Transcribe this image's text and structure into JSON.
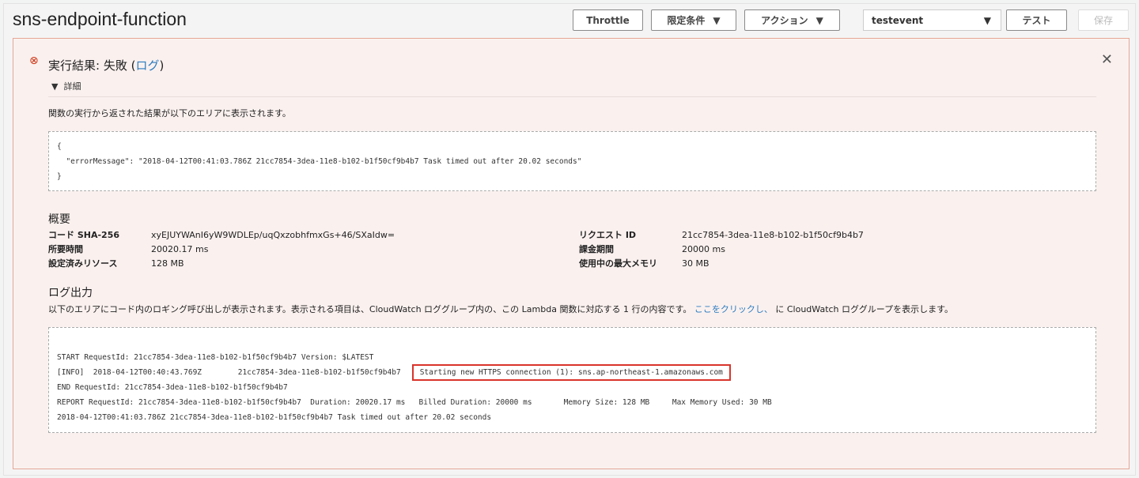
{
  "header": {
    "title": "sns-endpoint-function",
    "throttle": "Throttle",
    "qualifiers": "限定条件",
    "actions": "アクション",
    "test_event": "testevent",
    "test": "テスト",
    "save": "保存"
  },
  "result": {
    "title_prefix": "実行結果: 失敗 (",
    "log_link": "ログ",
    "title_suffix": ")",
    "details": "詳細",
    "description": "関数の実行から返された結果が以下のエリアに表示されます。",
    "output": [
      "{",
      "  \"errorMessage\": \"2018-04-12T00:41:03.786Z 21cc7854-3dea-11e8-b102-b1f50cf9b4b7 Task timed out after 20.02 seconds\"",
      "}"
    ]
  },
  "summary": {
    "heading": "概要",
    "left": [
      {
        "k": "コード SHA-256",
        "v": "xyEJUYWAnI6yW9WDLEp/uqQxzobhfmxGs+46/SXaIdw="
      },
      {
        "k": "所要時間",
        "v": "20020.17 ms"
      },
      {
        "k": "設定済みリソース",
        "v": "128 MB"
      }
    ],
    "right": [
      {
        "k": "リクエスト ID",
        "v": "21cc7854-3dea-11e8-b102-b1f50cf9b4b7"
      },
      {
        "k": "課金期間",
        "v": "20000 ms"
      },
      {
        "k": "使用中の最大メモリ",
        "v": "30 MB"
      }
    ]
  },
  "log": {
    "heading": "ログ出力",
    "desc_before": "以下のエリアにコード内のロギング呼び出しが表示されます。表示される項目は、CloudWatch ロググループ内の、この Lambda 関数に対応する 1 行の内容です。",
    "link": "ここをクリックし、",
    "desc_after": "に CloudWatch ロググループを表示します。",
    "line1": "START RequestId: 21cc7854-3dea-11e8-b102-b1f50cf9b4b7 Version: $LATEST",
    "line2_prefix": "[INFO]  2018-04-12T00:40:43.769Z        21cc7854-3dea-11e8-b102-b1f50cf9b4b7",
    "line2_message": "Starting new HTTPS connection (1): sns.ap-northeast-1.amazonaws.com",
    "line3": "END RequestId: 21cc7854-3dea-11e8-b102-b1f50cf9b4b7",
    "line4": "REPORT RequestId: 21cc7854-3dea-11e8-b102-b1f50cf9b4b7  Duration: 20020.17 ms   Billed Duration: 20000 ms       Memory Size: 128 MB     Max Memory Used: 30 MB",
    "line5": "2018-04-12T00:41:03.786Z 21cc7854-3dea-11e8-b102-b1f50cf9b4b7 Task timed out after 20.02 seconds"
  }
}
